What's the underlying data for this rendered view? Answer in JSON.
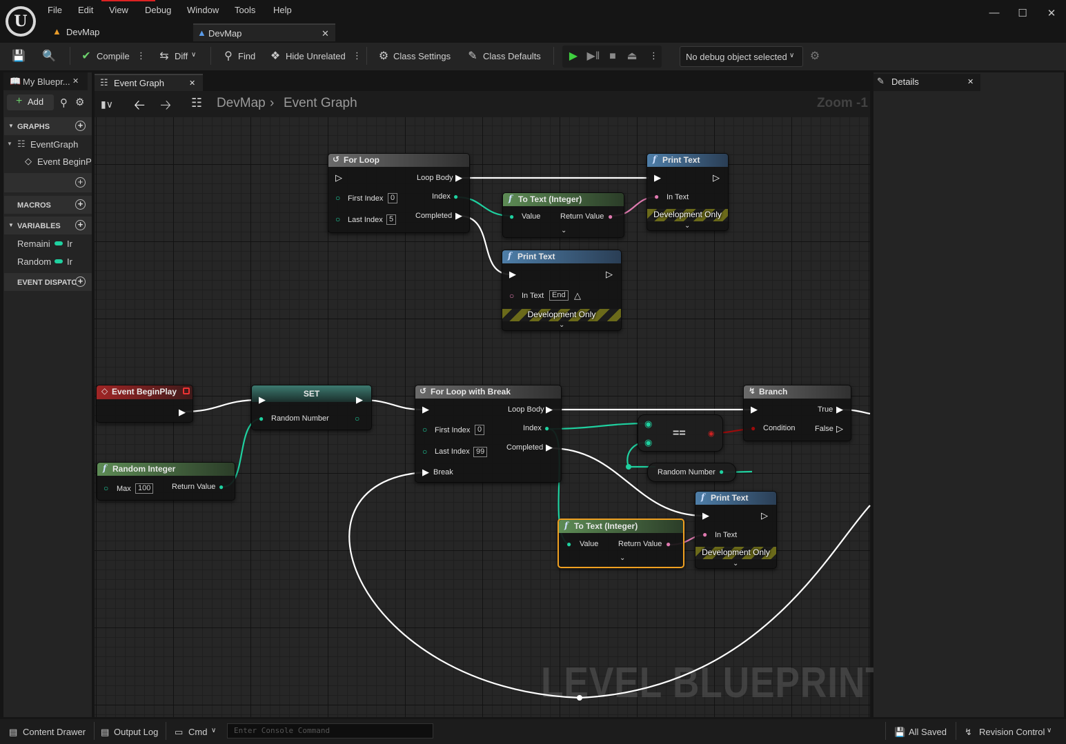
{
  "menu": [
    "File",
    "Edit",
    "View",
    "Debug",
    "Window",
    "Tools",
    "Help"
  ],
  "doc_tabs": [
    {
      "label": "DevMap"
    },
    {
      "label": "DevMap"
    }
  ],
  "toolbar": {
    "compile": "Compile",
    "diff": "Diff",
    "find": "Find",
    "hide_unrelated": "Hide Unrelated",
    "class_settings": "Class Settings",
    "class_defaults": "Class Defaults",
    "debug_object": "No debug object selected"
  },
  "my_blueprint": {
    "tab": "My Bluepr...",
    "add": "Add",
    "graphs": "GRAPHS",
    "event_graph": "EventGraph",
    "event_begin": "Event BeginP",
    "macros": "MACROS",
    "variables": "VARIABLES",
    "vars": [
      {
        "name": "Remaini",
        "type": "Ir"
      },
      {
        "name": "Random",
        "type": "Ir"
      }
    ],
    "event_dispatchers": "EVENT DISPATC"
  },
  "graph": {
    "tab": "Event Graph",
    "breadcrumb": [
      "DevMap",
      "Event Graph"
    ],
    "zoom": "Zoom -1",
    "watermark": "LEVEL BLUEPRINT"
  },
  "details": {
    "tab": "Details"
  },
  "nodes": {
    "for_loop": {
      "title": "For Loop",
      "loop_body": "Loop Body",
      "first_index": "First Index",
      "first_val": "0",
      "index": "Index",
      "last_index": "Last Index",
      "last_val": "5",
      "completed": "Completed"
    },
    "print_top": {
      "title": "Print Text",
      "in_text": "In Text",
      "dev": "Development Only"
    },
    "to_text_top": {
      "title": "To Text (Integer)",
      "value": "Value",
      "ret": "Return Value"
    },
    "print_mid": {
      "title": "Print Text",
      "in_text": "In Text",
      "in_val": "End",
      "dev": "Development Only"
    },
    "begin_play": {
      "title": "Event BeginPlay"
    },
    "set": {
      "title": "SET",
      "random_number": "Random Number"
    },
    "random_int": {
      "title": "Random Integer",
      "max": "Max",
      "max_val": "100",
      "ret": "Return Value"
    },
    "for_break": {
      "title": "For Loop with Break",
      "loop_body": "Loop Body",
      "first_index": "First Index",
      "first_val": "0",
      "index": "Index",
      "last_index": "Last Index",
      "last_val": "99",
      "completed": "Completed",
      "break": "Break"
    },
    "equals": {
      "title": "=="
    },
    "random_get": {
      "title": "Random Number"
    },
    "branch": {
      "title": "Branch",
      "true": "True",
      "condition": "Condition",
      "false": "False"
    },
    "print_bot": {
      "title": "Print Text",
      "in_text": "In Text",
      "dev": "Development Only"
    },
    "to_text_sel": {
      "title": "To Text (Integer)",
      "value": "Value",
      "ret": "Return Value"
    }
  },
  "status": {
    "content_drawer": "Content Drawer",
    "output_log": "Output Log",
    "cmd": "Cmd",
    "console_placeholder": "Enter Console Command",
    "all_saved": "All Saved",
    "revision_control": "Revision Control"
  },
  "colors": {
    "exec": "#ffffff",
    "int_pin": "#1fd1a0",
    "text_pin": "#e07ab0",
    "bool_pin": "#9c0b0b",
    "selected": "#f0a020"
  }
}
